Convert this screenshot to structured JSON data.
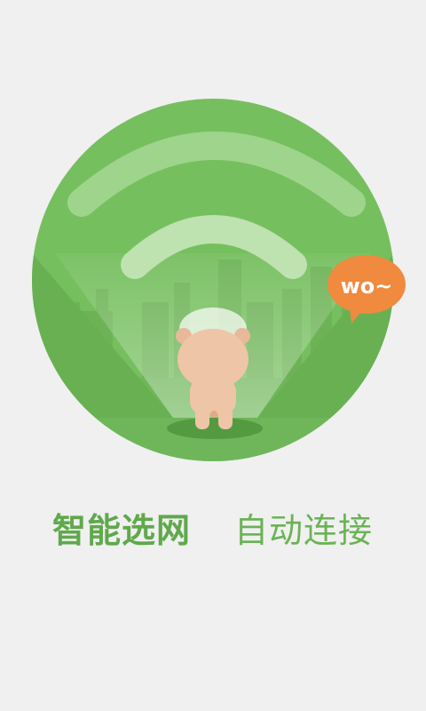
{
  "splash": {
    "badge_text": "wo~",
    "tagline_primary": "智能选网",
    "tagline_secondary": "自动连接"
  },
  "colors": {
    "background": "#f0f0f0",
    "circle": "#76bf5f",
    "accent_text": "#5fa94c",
    "badge": "#ef8a3e",
    "bear": "#eec5a7"
  }
}
